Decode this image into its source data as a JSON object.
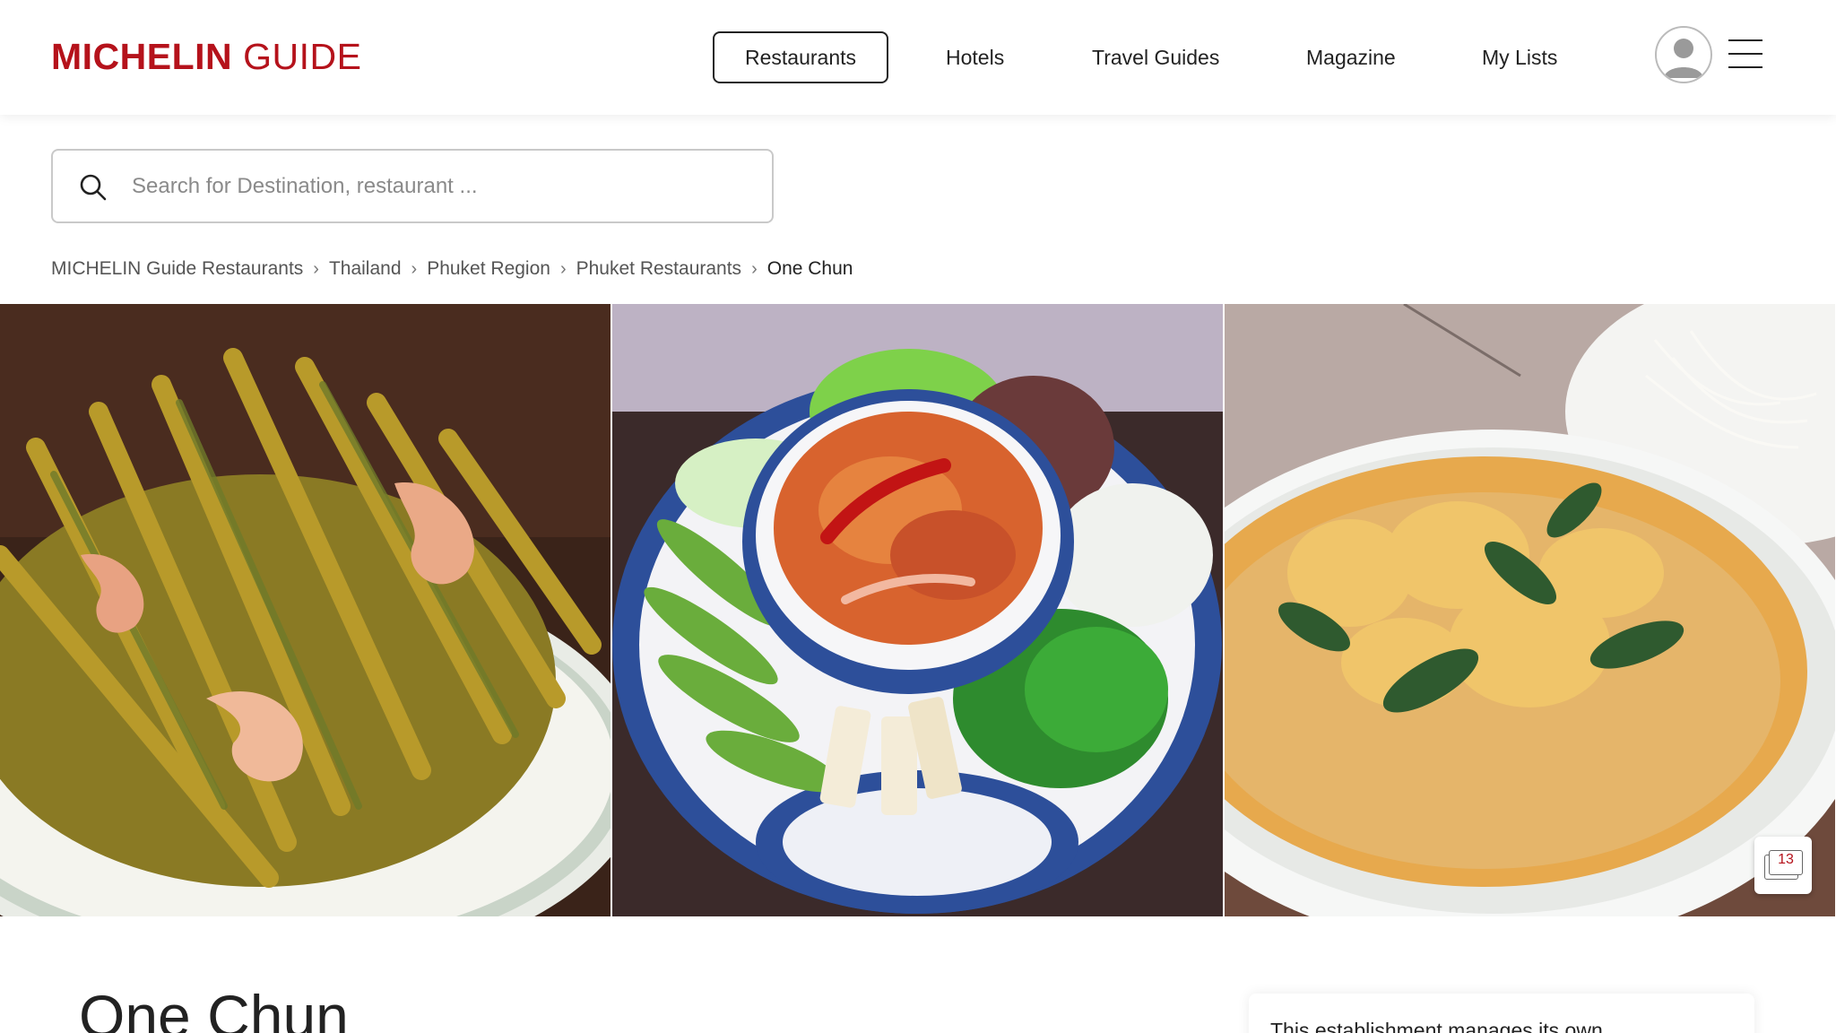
{
  "brand": {
    "name_bold": "MICHELIN",
    "name_light": "GUIDE",
    "color": "#b5121b"
  },
  "nav": {
    "items": [
      {
        "label": "Restaurants",
        "active": true
      },
      {
        "label": "Hotels"
      },
      {
        "label": "Travel Guides"
      },
      {
        "label": "Magazine"
      },
      {
        "label": "My Lists"
      }
    ],
    "icons": {
      "avatar": "user-avatar-icon",
      "menu": "hamburger-menu-icon"
    }
  },
  "search": {
    "placeholder": "Search for Destination, restaurant ...",
    "value": "",
    "icon": "search-icon"
  },
  "breadcrumb": [
    {
      "label": "MICHELIN Guide Restaurants"
    },
    {
      "label": "Thailand"
    },
    {
      "label": "Phuket Region"
    },
    {
      "label": "Phuket Restaurants"
    },
    {
      "label": "One Chun"
    }
  ],
  "gallery": {
    "photo_count": "13",
    "icon": "photo-stack-icon"
  },
  "restaurant": {
    "name": "One Chun"
  },
  "side_card": {
    "text": "This establishment manages its own"
  }
}
